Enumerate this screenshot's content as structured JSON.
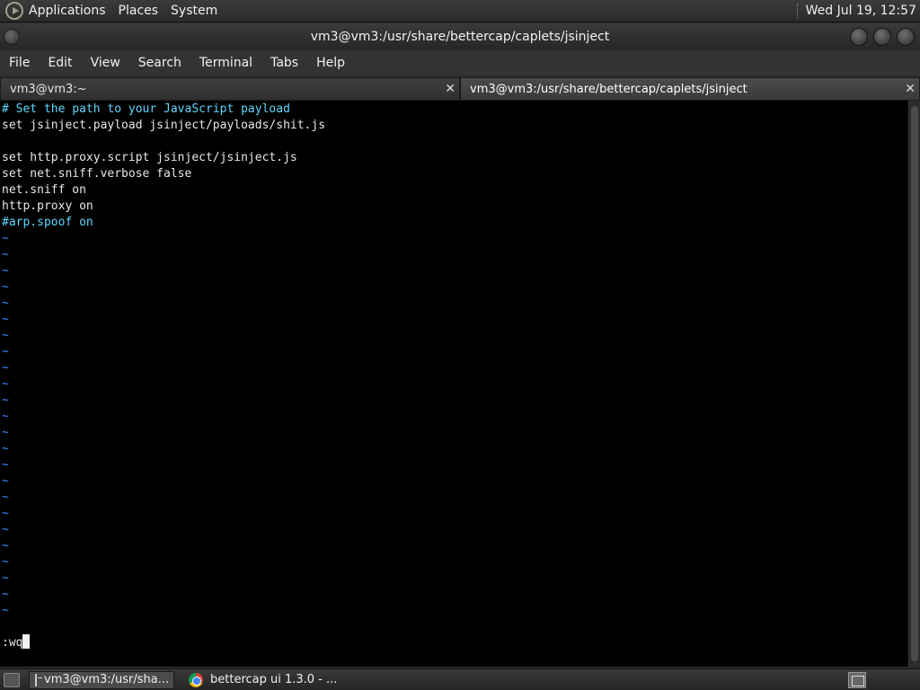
{
  "panel": {
    "menus": [
      "Applications",
      "Places",
      "System"
    ],
    "clock": "Wed Jul 19, 12:57"
  },
  "window": {
    "title": "vm3@vm3:/usr/share/bettercap/caplets/jsinject"
  },
  "menubar": {
    "items": [
      "File",
      "Edit",
      "View",
      "Search",
      "Terminal",
      "Tabs",
      "Help"
    ]
  },
  "tabs": [
    {
      "label": "vm3@vm3:~",
      "close": "✕"
    },
    {
      "label": "vm3@vm3:/usr/share/bettercap/caplets/jsinject",
      "close": "✕"
    }
  ],
  "editor": {
    "lines": [
      "# Set the path to your JavaScript payload",
      "set jsinject.payload jsinject/payloads/shit.js",
      "",
      "set http.proxy.script jsinject/jsinject.js",
      "set net.sniff.verbose false",
      "net.sniff on",
      "http.proxy on",
      "#arp.spoof on"
    ],
    "tilde": "~",
    "command": ":wq"
  },
  "taskbar": {
    "items": [
      {
        "label": "vm3@vm3:/usr/sha...",
        "icon": "terminal-icon"
      },
      {
        "label": "bettercap ui 1.3.0 - ...",
        "icon": "chrome-icon"
      }
    ]
  },
  "colors": {
    "comment": "#5fd7ff",
    "tilde": "#3a8cff",
    "background": "#000000"
  }
}
